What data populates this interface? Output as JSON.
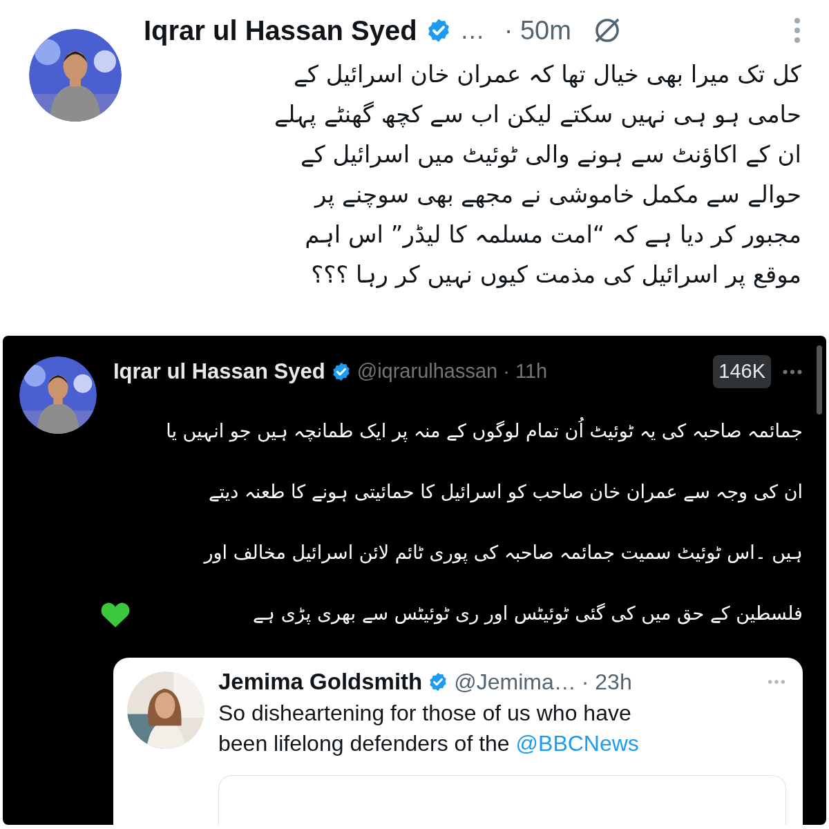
{
  "top_tweet": {
    "author": "Iqrar ul Hassan Syed",
    "verified": true,
    "handle": "…",
    "time": "· 50m",
    "lines": [
      "کل تک میرا بھی خیال تھا کہ عمران خان اسرائیل کے",
      "حامی ہو ہی نہیں سکتے لیکن اب سے کچھ گھنٹے پہلے",
      "ان کے اکاؤنٹ سے ہونے والی ٹوئیٹ میں اسرائیل کے",
      "حوالے سے مکمل خاموشی نے مجھے بھی سوچنے پر",
      "مجبور کر دیا ہے کہ “امت مسلمہ کا لیڈر” اس اہم",
      "موقع پر اسرائیل کی مذمت کیوں نہیں کر رہا ؟؟؟"
    ]
  },
  "reply_tweet": {
    "author": "Iqrar ul Hassan Syed",
    "verified": true,
    "handle": "@iqrarulhassan",
    "time": "· 11h",
    "views": "146K",
    "lines": [
      "جمائمہ صاحبہ کی یہ ٹوئیٹ اُن تمام لوگوں کے منہ پر ایک طمانچہ ہیں جو انہیں یا",
      "ان کی وجہ سے عمران خان صاحب کو اسرائیل کا حمائیتی ہونے کا طعنہ دیتے",
      "ہیں ۔اس ٹوئیٹ سمیت جمائمہ صاحبہ کی پوری ٹائم لائن اسرائیل مخالف اور",
      "فلسطین کے حق میں کی گئی ٹوئیٹس اور ری ٹوئیٹس سے بھری پڑی ہے"
    ]
  },
  "quoted_tweet": {
    "author": "Jemima Goldsmith",
    "verified": true,
    "handle": "@Jemima…",
    "time": "· 23h",
    "lines": [
      "So disheartening for those of us who have",
      "been lifelong defenders of the"
    ],
    "mention": "@BBCNews"
  }
}
